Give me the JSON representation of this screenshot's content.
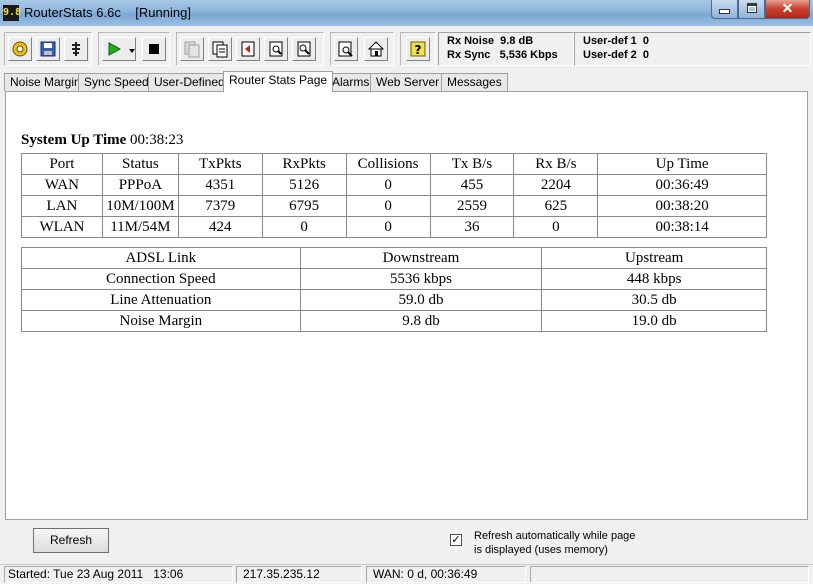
{
  "app": {
    "icon_text": "9.8",
    "title": "RouterStats 6.6c    [Running]"
  },
  "toolbar": {
    "buttons": [
      {
        "name": "settings-icon"
      },
      {
        "name": "save-icon"
      },
      {
        "name": "connect-icon"
      },
      {
        "name": "play-icon"
      },
      {
        "name": "dropdown-arrow-icon"
      },
      {
        "name": "stop-icon"
      },
      {
        "name": "copy-icon"
      },
      {
        "name": "paste-icon"
      },
      {
        "name": "export-icon"
      },
      {
        "name": "find-icon"
      },
      {
        "name": "zoom-icon"
      },
      {
        "name": "report-icon"
      },
      {
        "name": "home-icon"
      },
      {
        "name": "help-icon"
      }
    ],
    "rx_noise": "Rx Noise  9.8 dB",
    "rx_sync": "Rx Sync   5,536 Kbps",
    "user_def_1": "User-def 1  0",
    "user_def_2": "User-def 2  0"
  },
  "tabs": [
    {
      "label": "Noise Margin"
    },
    {
      "label": "Sync Speed"
    },
    {
      "label": "User-Defined"
    },
    {
      "label": "Router Stats Page",
      "active": true
    },
    {
      "label": "Alarms"
    },
    {
      "label": "Web Server"
    },
    {
      "label": "Messages"
    }
  ],
  "content": {
    "uptime_label": "System Up Time",
    "uptime_value": "00:38:23",
    "ports_table": {
      "headers": [
        "Port",
        "Status",
        "TxPkts",
        "RxPkts",
        "Collisions",
        "Tx B/s",
        "Rx B/s",
        "Up Time"
      ],
      "rows": [
        [
          "WAN",
          "PPPoA",
          "4351",
          "5126",
          "0",
          "455",
          "2204",
          "00:36:49"
        ],
        [
          "LAN",
          "10M/100M",
          "7379",
          "6795",
          "0",
          "2559",
          "625",
          "00:38:20"
        ],
        [
          "WLAN",
          "11M/54M",
          "424",
          "0",
          "0",
          "36",
          "0",
          "00:38:14"
        ]
      ]
    },
    "adsl_table": {
      "headers": [
        "ADSL Link",
        "Downstream",
        "Upstream"
      ],
      "rows": [
        [
          "Connection Speed",
          "5536 kbps",
          "448 kbps"
        ],
        [
          "Line Attenuation",
          "59.0 db",
          "30.5 db"
        ],
        [
          "Noise Margin",
          "9.8 db",
          "19.0 db"
        ]
      ]
    }
  },
  "bottom": {
    "refresh_label": "Refresh",
    "auto_refresh_checked": true,
    "checkmark": "✓",
    "auto_refresh_line1": "Refresh automatically while page",
    "auto_refresh_line2": "is displayed (uses memory)"
  },
  "statusbar": {
    "started": "Started: Tue 23 Aug 2011   13:06",
    "ip": "217.35.235.12",
    "wan": "WAN: 0 d, 00:36:49"
  }
}
